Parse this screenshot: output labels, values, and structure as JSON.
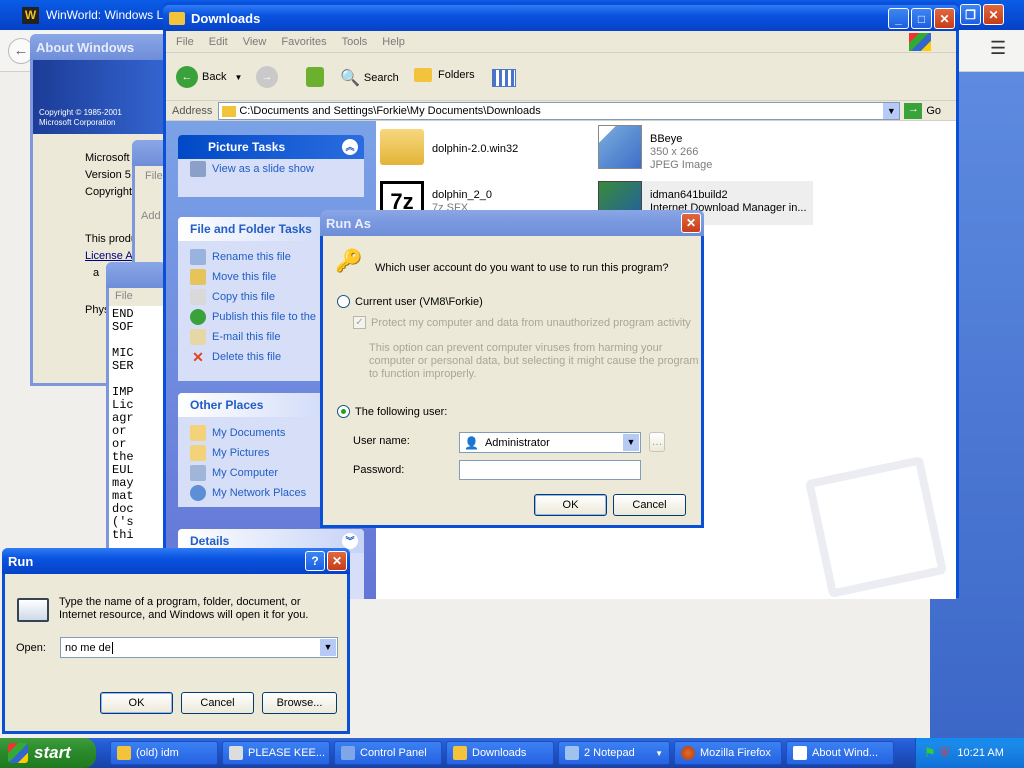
{
  "firefox": {
    "title": "WinWorld: Windows Lon"
  },
  "about": {
    "title": "About Windows",
    "copyright1": "Copyright © 1985-2001",
    "copyright2": "Microsoft Corporation",
    "l1": "Microsoft",
    "l2": "Version 5.",
    "l3": "Copyright",
    "l4": "This produ",
    "l5": "License A",
    "l6": "a",
    "l7": "Phys"
  },
  "notepad": {
    "lines": [
      "END",
      "SOF",
      "",
      "MIC",
      "SER",
      "",
      "IMP",
      "Lic",
      "agr",
      "or",
      "or",
      "the",
      "EUL",
      "may",
      "mat",
      "doc",
      "('s",
      "thi"
    ],
    "menu": "File"
  },
  "cp": {
    "menu": "File",
    "addr": "Add"
  },
  "downloads": {
    "title": "Downloads",
    "menu": [
      "File",
      "Edit",
      "View",
      "Favorites",
      "Tools",
      "Help"
    ],
    "toolbar": {
      "back": "Back",
      "search": "Search",
      "folders": "Folders"
    },
    "address_label": "Address",
    "address": "C:\\Documents and Settings\\Forkie\\My Documents\\Downloads",
    "go": "Go",
    "picture_tasks": {
      "title": "Picture Tasks",
      "items": [
        "View as a slide show"
      ]
    },
    "file_tasks": {
      "title": "File and Folder Tasks",
      "items": [
        "Rename this file",
        "Move this file",
        "Copy this file",
        "Publish this file to the",
        "E-mail this file",
        "Delete this file"
      ]
    },
    "other_places": {
      "title": "Other Places",
      "items": [
        "My Documents",
        "My Pictures",
        "My Computer",
        "My Network Places"
      ]
    },
    "details": {
      "title": "Details"
    },
    "files": [
      {
        "name": "dolphin-2.0.win32",
        "sub1": "",
        "sub2": ""
      },
      {
        "name": "BBeye",
        "sub1": "350 x 266",
        "sub2": "JPEG Image"
      },
      {
        "name": "dolphin_2_0",
        "sub1": "7z SFX",
        "sub2": ""
      },
      {
        "name": "idman641build2",
        "sub1": "Internet Download Manager in...",
        "sub2": ""
      }
    ]
  },
  "runas": {
    "title": "Run As",
    "question": "Which user account do you want to use to run this program?",
    "current_user": "Current user (VM8\\Forkie)",
    "protect": "Protect my computer and data from unauthorized program activity",
    "note": "This option can prevent computer viruses from harming your computer or personal data, but selecting it might cause the program to function improperly.",
    "following_user": "The following user:",
    "username_label": "User name:",
    "username": "Administrator",
    "password_label": "Password:",
    "ok": "OK",
    "cancel": "Cancel"
  },
  "run": {
    "title": "Run",
    "prompt": "Type the name of a program, folder, document, or Internet resource, and Windows will open it for you.",
    "open_label": "Open:",
    "open_value": "no me de",
    "ok": "OK",
    "cancel": "Cancel",
    "browse": "Browse..."
  },
  "taskbar": {
    "start": "start",
    "tasks": [
      "(old) idm",
      "PLEASE KEE...",
      "Control Panel",
      "Downloads",
      "2 Notepad",
      "Mozilla Firefox",
      "About Wind..."
    ],
    "clock": "10:21 AM"
  }
}
